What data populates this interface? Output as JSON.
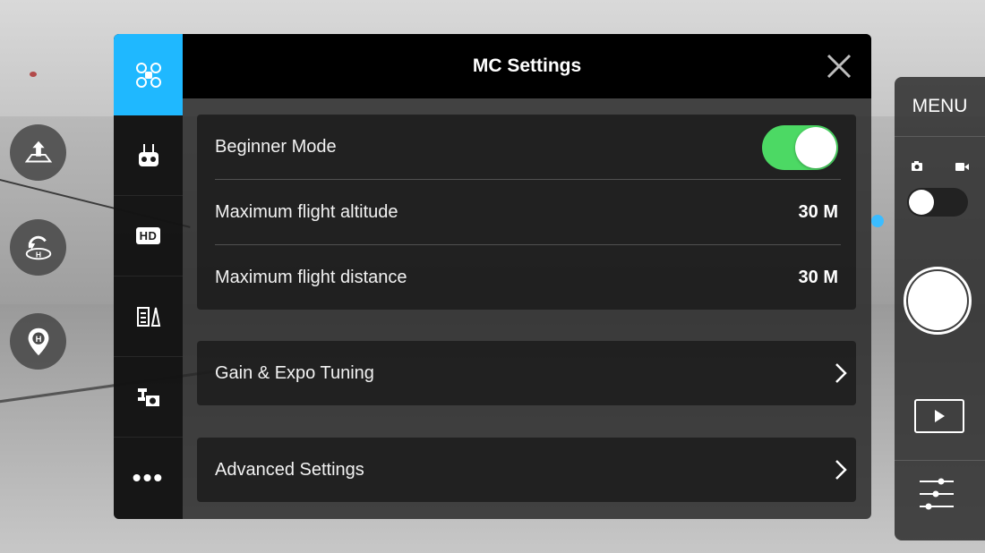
{
  "header": {
    "title": "MC Settings"
  },
  "settings": {
    "beginner_mode": {
      "label": "Beginner Mode",
      "enabled": true
    },
    "max_altitude": {
      "label": "Maximum flight altitude",
      "value": "30 M"
    },
    "max_distance": {
      "label": "Maximum flight distance",
      "value": "30 M"
    },
    "gain_expo": {
      "label": "Gain & Expo Tuning"
    },
    "advanced": {
      "label": "Advanced Settings"
    }
  },
  "tabs": [
    {
      "name": "aircraft-icon"
    },
    {
      "name": "remote-controller-icon"
    },
    {
      "name": "hd-transmission",
      "label": "HD"
    },
    {
      "name": "checklist-icon"
    },
    {
      "name": "gimbal-icon"
    },
    {
      "name": "more",
      "label": "•••"
    }
  ],
  "camera_panel": {
    "menu_label": "MENU",
    "mode": "photo"
  },
  "colors": {
    "accent": "#1fb8ff",
    "toggle_on": "#4cd964"
  }
}
